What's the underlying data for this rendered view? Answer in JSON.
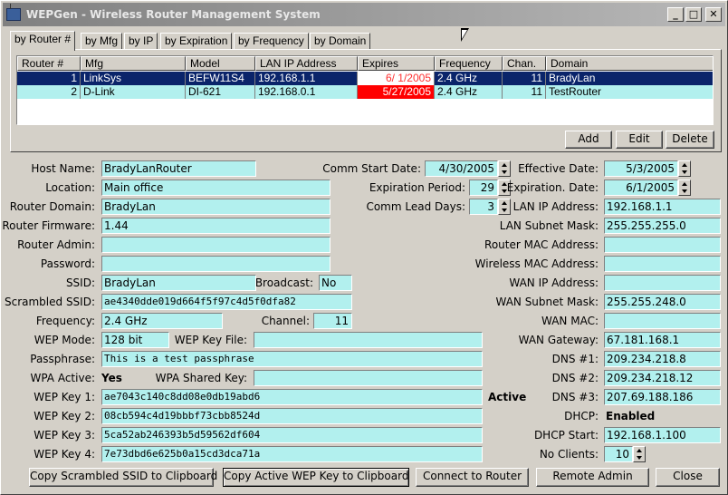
{
  "window": {
    "title": "WEPGen - Wireless Router Management System",
    "min": "_",
    "max": "□",
    "close": "✕"
  },
  "tabs": [
    "by Router #",
    "by Mfg",
    "by IP",
    "by Expiration",
    "by Frequency",
    "by Domain"
  ],
  "grid": {
    "headers": [
      "Router #",
      "Mfg",
      "Model",
      "LAN IP Address",
      "Expires",
      "Frequency",
      "Chan.",
      "Domain"
    ],
    "rows": [
      [
        "1",
        "LinkSys",
        "BEFW11S4",
        "192.168.1.1",
        "6/ 1/2005",
        "2.4 GHz",
        "11",
        "BradyLan"
      ],
      [
        "2",
        "D-Link",
        "DI-621",
        "192.168.0.1",
        "5/27/2005",
        "2.4 GHz",
        "11",
        "TestRouter"
      ]
    ]
  },
  "grid_buttons": {
    "add": "Add",
    "edit": "Edit",
    "delete": "Delete"
  },
  "left": {
    "host_name": {
      "label": "Host Name:",
      "value": "BradyLanRouter"
    },
    "location": {
      "label": "Location:",
      "value": "Main office"
    },
    "router_domain": {
      "label": "Router Domain:",
      "value": "BradyLan"
    },
    "router_firmware": {
      "label": "Router Firmware:",
      "value": "1.44"
    },
    "router_admin": {
      "label": "Router Admin:",
      "value": ""
    },
    "password": {
      "label": "Password:",
      "value": ""
    },
    "ssid": {
      "label": "SSID:",
      "value": "BradyLan"
    },
    "broadcast": {
      "label": "Broadcast:",
      "value": "No"
    },
    "scrambled_ssid": {
      "label": "Scrambled SSID:",
      "value": "ae4340dde019d664f5f97c4d5f0dfa82"
    },
    "frequency": {
      "label": "Frequency:",
      "value": "2.4 GHz"
    },
    "channel": {
      "label": "Channel:",
      "value": "11"
    },
    "wep_mode": {
      "label": "WEP Mode:",
      "value": "128 bit"
    },
    "wep_key_file": {
      "label": "WEP Key File:",
      "value": ""
    },
    "passphrase": {
      "label": "Passphrase:",
      "value": "This is a test passphrase"
    },
    "wpa_active": {
      "label": "WPA Active:",
      "value": "Yes"
    },
    "wpa_shared_key": {
      "label": "WPA Shared Key:",
      "value": ""
    },
    "wep_key_1": {
      "label": "WEP Key 1:",
      "value": "ae7043c140c8dd08e0db19abd6"
    },
    "wep_key_2": {
      "label": "WEP Key 2:",
      "value": "08cb594c4d19bbbf73cbb8524d"
    },
    "wep_key_3": {
      "label": "WEP Key 3:",
      "value": "5ca52ab246393b5d59562df604"
    },
    "wep_key_4": {
      "label": "WEP Key 4:",
      "value": "7e73dbd6e625b0a15cd3dca71a"
    },
    "active_label": "Active"
  },
  "middle": {
    "comm_start_date": {
      "label": "Comm Start Date:",
      "value": "4/30/2005"
    },
    "expiration_period": {
      "label": "Expiration Period:",
      "value": "29"
    },
    "comm_lead_days": {
      "label": "Comm Lead Days:",
      "value": "3"
    }
  },
  "right": {
    "effective_date": {
      "label": "Effective Date:",
      "value": "5/3/2005"
    },
    "expiration_date": {
      "label": "Expiration. Date:",
      "value": "6/1/2005"
    },
    "lan_ip": {
      "label": "LAN IP Address:",
      "value": "192.168.1.1"
    },
    "lan_subnet": {
      "label": "LAN Subnet Mask:",
      "value": "255.255.255.0"
    },
    "router_mac": {
      "label": "Router MAC Address:",
      "value": ""
    },
    "wireless_mac": {
      "label": "Wireless MAC Address:",
      "value": ""
    },
    "wan_ip": {
      "label": "WAN IP Address:",
      "value": ""
    },
    "wan_subnet": {
      "label": "WAN Subnet Mask:",
      "value": "255.255.248.0"
    },
    "wan_mac": {
      "label": "WAN MAC:",
      "value": ""
    },
    "wan_gateway": {
      "label": "WAN Gateway:",
      "value": "67.181.168.1"
    },
    "dns1": {
      "label": "DNS #1:",
      "value": "209.234.218.8"
    },
    "dns2": {
      "label": "DNS #2:",
      "value": "209.234.218.12"
    },
    "dns3": {
      "label": "DNS #3:",
      "value": "207.69.188.186"
    },
    "dhcp": {
      "label": "DHCP:",
      "value": "Enabled"
    },
    "dhcp_start": {
      "label": "DHCP Start:",
      "value": "192.168.1.100"
    },
    "no_clients": {
      "label": "No  Clients:",
      "value": "10"
    }
  },
  "bottom_buttons": {
    "copy_ssid": "Copy Scrambled SSID to Clipboard",
    "copy_wep": "Copy Active WEP Key to Clipboard",
    "connect": "Connect to Router",
    "remote_admin": "Remote Admin",
    "close": "Close"
  },
  "colors": {
    "field_bg": "#b2f0ee",
    "selection": "#0a246a",
    "expired_red": "#ff0000",
    "window_bg": "#d4d0c8"
  }
}
